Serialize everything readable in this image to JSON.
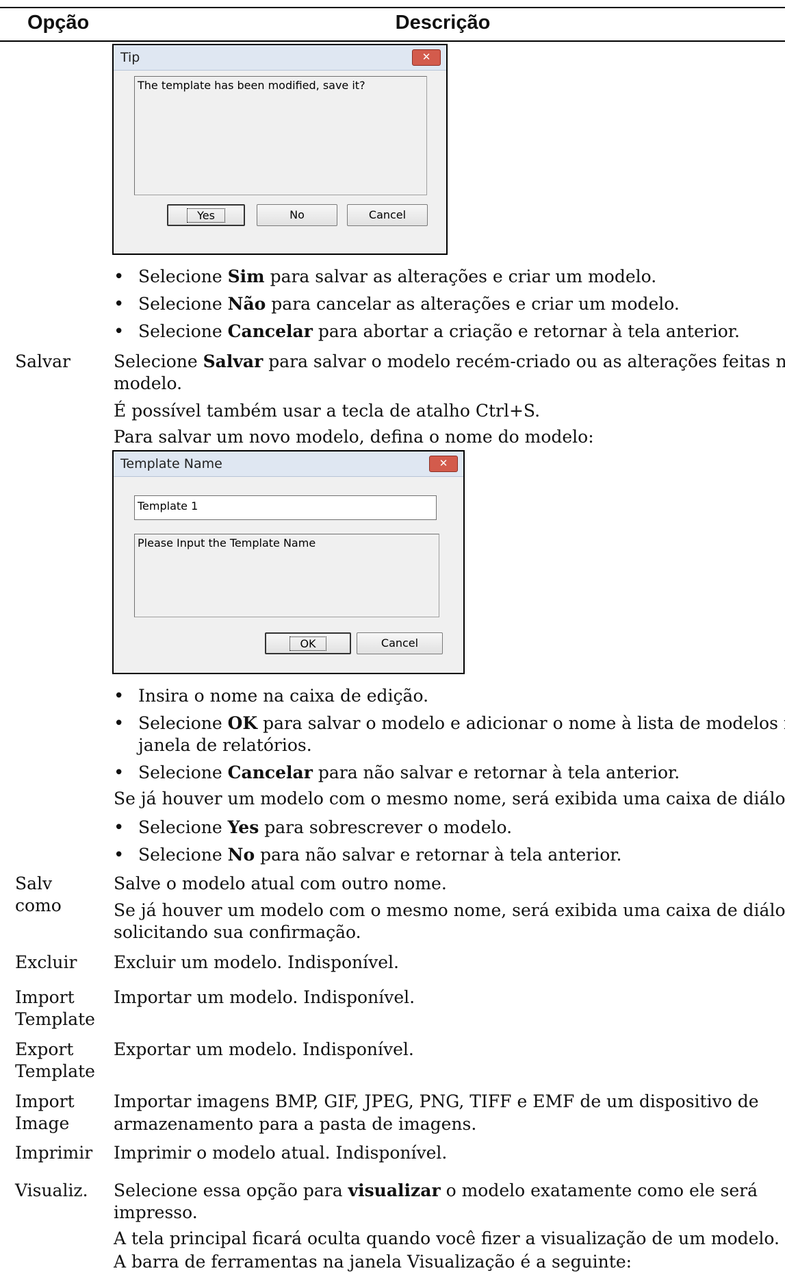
{
  "header": {
    "option": "Opção",
    "description": "Descrição"
  },
  "tip_dialog": {
    "title": "Tip",
    "close": "✕",
    "message": "The template has been modified, save it?",
    "buttons": {
      "yes": "Yes",
      "no": "No",
      "cancel": "Cancel"
    }
  },
  "tip_bullets": [
    {
      "pre": "Selecione ",
      "bold": "Sim",
      "post": " para salvar as alterações e criar um modelo."
    },
    {
      "pre": "Selecione ",
      "bold": "Não",
      "post": " para cancelar as alterações e criar um modelo."
    },
    {
      "pre": "Selecione ",
      "bold": "Cancelar",
      "post": " para abortar a criação e retornar à tela anterior."
    }
  ],
  "salvar": {
    "label": "Salvar",
    "l1_pre": "Selecione ",
    "l1_bold": "Salvar",
    "l1_post": " para salvar o modelo recém-criado ou as alterações feitas no",
    "l2": "modelo.",
    "l3": "É possível também usar a tecla de atalho Ctrl+S.",
    "l4": "Para salvar um novo modelo, defina o nome do modelo:"
  },
  "name_dialog": {
    "title": "Template Name",
    "close": "✕",
    "value": "Template 1",
    "message": "Please Input the Template Name",
    "buttons": {
      "ok": "OK",
      "cancel": "Cancel"
    }
  },
  "name_bullets": [
    {
      "pre": "",
      "bold": "",
      "post": "Insira o nome na caixa de edição."
    },
    {
      "pre": "Selecione ",
      "bold": "OK",
      "post": " para salvar o modelo e adicionar o nome à lista de modelos na"
    },
    {
      "pre": "Selecione ",
      "bold": "Cancelar",
      "post": " para não salvar e retornar à tela anterior."
    }
  ],
  "name_bullet2_cont": "janela de relatórios.",
  "duplicate_note": "Se já houver um modelo com o mesmo nome, será exibida uma caixa de diálogo.",
  "dup_bullets": [
    {
      "pre": "Selecione ",
      "bold": "Yes",
      "post": " para sobrescrever o modelo."
    },
    {
      "pre": "Selecione ",
      "bold": "No",
      "post": " para não salvar e retornar à tela anterior."
    }
  ],
  "rows": {
    "salv_como": {
      "label1": "Salv",
      "label2": "como",
      "d1": "Salve o modelo atual com outro nome.",
      "d2": "Se já houver um modelo com o mesmo nome, será exibida uma caixa de diálogo",
      "d3": "solicitando sua confirmação."
    },
    "excluir": {
      "label": "Excluir",
      "d1": "Excluir um modelo. Indisponível."
    },
    "import_template": {
      "label1": "Import",
      "label2": "Template",
      "d1": "Importar um modelo. Indisponível."
    },
    "export_template": {
      "label1": "Export",
      "label2": "Template",
      "d1": "Exportar um modelo. Indisponível."
    },
    "import_image": {
      "label1": "Import",
      "label2": "Image",
      "d1": "Importar imagens BMP, GIF, JPEG, PNG, TIFF e EMF de um dispositivo de",
      "d2": "armazenamento para a pasta de imagens."
    },
    "imprimir": {
      "label": "Imprimir",
      "d1": "Imprimir o modelo atual. Indisponível."
    },
    "visualiz": {
      "label": "Visualiz.",
      "d1_pre": "Selecione essa opção para ",
      "d1_bold": "visualizar",
      "d1_post": " o modelo exatamente como ele será",
      "d2": "impresso.",
      "d3": "A tela principal ficará oculta quando você fizer a visualização de um modelo.",
      "d4": "A barra de ferramentas na janela Visualização é a seguinte:"
    }
  }
}
